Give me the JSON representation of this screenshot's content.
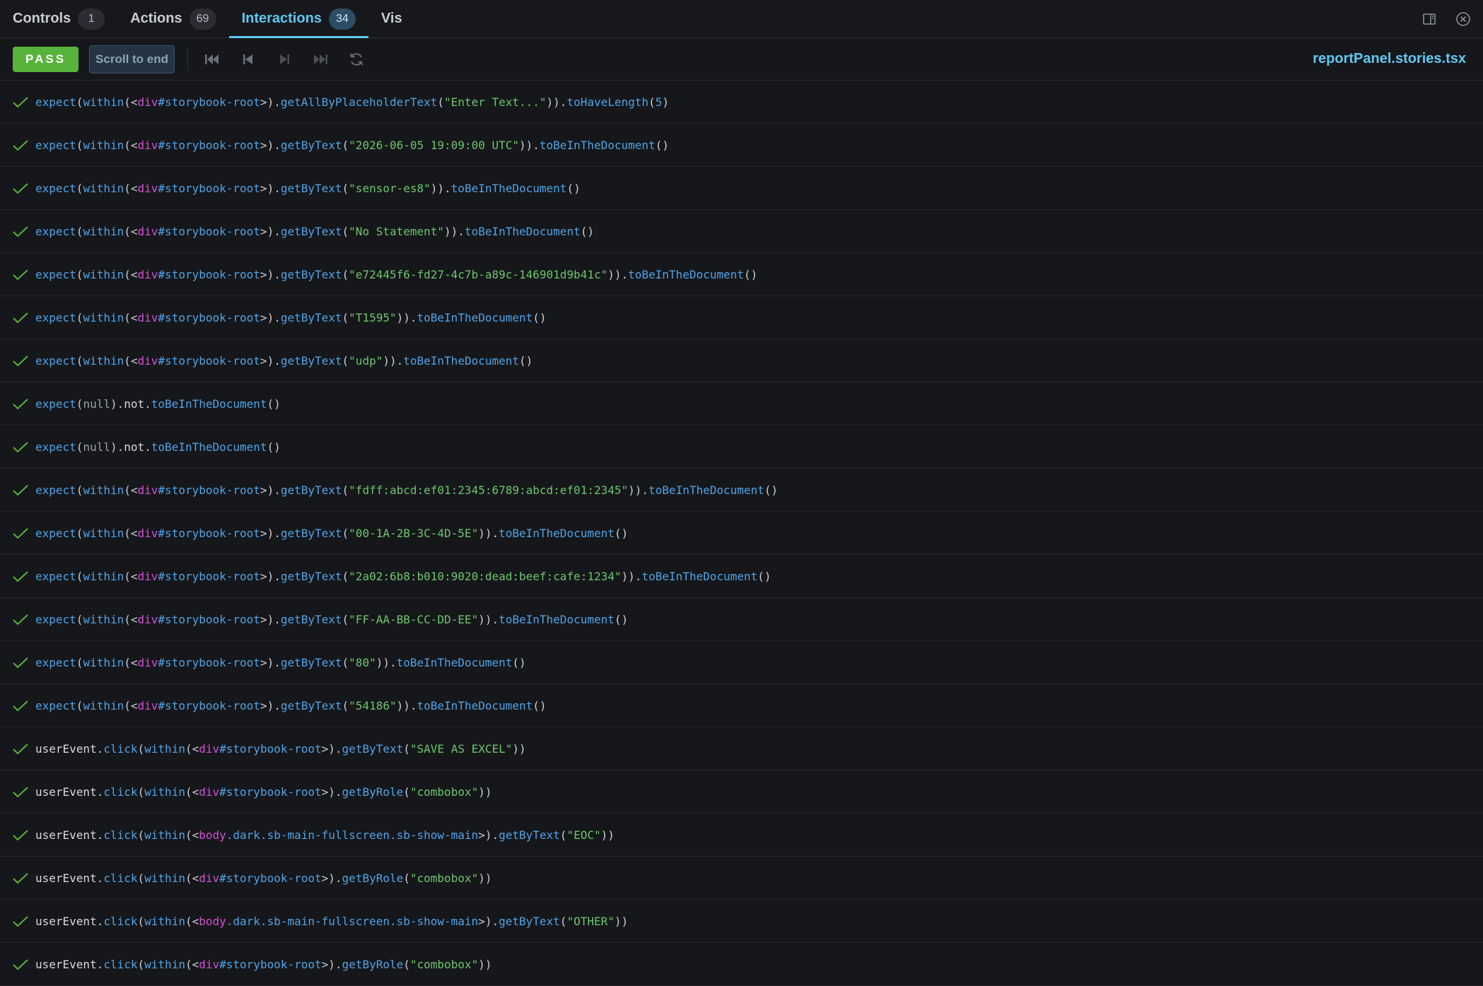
{
  "tabs": [
    {
      "label": "Controls",
      "count": "1"
    },
    {
      "label": "Actions",
      "count": "69"
    },
    {
      "label": "Interactions",
      "count": "34"
    },
    {
      "label": "Vis"
    }
  ],
  "toolbar": {
    "status": "PASS",
    "scroll_label": "Scroll to end",
    "filename": "reportPanel.stories.tsx"
  },
  "rows": [
    {
      "parts": [
        [
          "kw",
          "expect"
        ],
        [
          "pl",
          "("
        ],
        [
          "kw",
          "within"
        ],
        [
          "pl",
          "("
        ],
        [
          "pl",
          "<"
        ],
        [
          "el",
          "div"
        ],
        [
          "sel",
          "#storybook-root"
        ],
        [
          "pl",
          ">"
        ],
        [
          "pl",
          ")."
        ],
        [
          "kw",
          "getAllByPlaceholderText"
        ],
        [
          "pl",
          "("
        ],
        [
          "str",
          "\"Enter Text...\""
        ],
        [
          "pl",
          "))."
        ],
        [
          "kw",
          "toHaveLength"
        ],
        [
          "pl",
          "("
        ],
        [
          "num",
          "5"
        ],
        [
          "pl",
          ")"
        ]
      ]
    },
    {
      "parts": [
        [
          "kw",
          "expect"
        ],
        [
          "pl",
          "("
        ],
        [
          "kw",
          "within"
        ],
        [
          "pl",
          "("
        ],
        [
          "pl",
          "<"
        ],
        [
          "el",
          "div"
        ],
        [
          "sel",
          "#storybook-root"
        ],
        [
          "pl",
          ">"
        ],
        [
          "pl",
          ")."
        ],
        [
          "kw",
          "getByText"
        ],
        [
          "pl",
          "("
        ],
        [
          "str",
          "\"2026-06-05 19:09:00 UTC\""
        ],
        [
          "pl",
          "))."
        ],
        [
          "kw",
          "toBeInTheDocument"
        ],
        [
          "pl",
          "()"
        ]
      ]
    },
    {
      "parts": [
        [
          "kw",
          "expect"
        ],
        [
          "pl",
          "("
        ],
        [
          "kw",
          "within"
        ],
        [
          "pl",
          "("
        ],
        [
          "pl",
          "<"
        ],
        [
          "el",
          "div"
        ],
        [
          "sel",
          "#storybook-root"
        ],
        [
          "pl",
          ">"
        ],
        [
          "pl",
          ")."
        ],
        [
          "kw",
          "getByText"
        ],
        [
          "pl",
          "("
        ],
        [
          "str",
          "\"sensor-es8\""
        ],
        [
          "pl",
          "))."
        ],
        [
          "kw",
          "toBeInTheDocument"
        ],
        [
          "pl",
          "()"
        ]
      ]
    },
    {
      "parts": [
        [
          "kw",
          "expect"
        ],
        [
          "pl",
          "("
        ],
        [
          "kw",
          "within"
        ],
        [
          "pl",
          "("
        ],
        [
          "pl",
          "<"
        ],
        [
          "el",
          "div"
        ],
        [
          "sel",
          "#storybook-root"
        ],
        [
          "pl",
          ">"
        ],
        [
          "pl",
          ")."
        ],
        [
          "kw",
          "getByText"
        ],
        [
          "pl",
          "("
        ],
        [
          "str",
          "\"No Statement\""
        ],
        [
          "pl",
          "))."
        ],
        [
          "kw",
          "toBeInTheDocument"
        ],
        [
          "pl",
          "()"
        ]
      ]
    },
    {
      "parts": [
        [
          "kw",
          "expect"
        ],
        [
          "pl",
          "("
        ],
        [
          "kw",
          "within"
        ],
        [
          "pl",
          "("
        ],
        [
          "pl",
          "<"
        ],
        [
          "el",
          "div"
        ],
        [
          "sel",
          "#storybook-root"
        ],
        [
          "pl",
          ">"
        ],
        [
          "pl",
          ")."
        ],
        [
          "kw",
          "getByText"
        ],
        [
          "pl",
          "("
        ],
        [
          "str",
          "\"e72445f6-fd27-4c7b-a89c-146901d9b41c\""
        ],
        [
          "pl",
          "))."
        ],
        [
          "kw",
          "toBeInTheDocument"
        ],
        [
          "pl",
          "()"
        ]
      ]
    },
    {
      "parts": [
        [
          "kw",
          "expect"
        ],
        [
          "pl",
          "("
        ],
        [
          "kw",
          "within"
        ],
        [
          "pl",
          "("
        ],
        [
          "pl",
          "<"
        ],
        [
          "el",
          "div"
        ],
        [
          "sel",
          "#storybook-root"
        ],
        [
          "pl",
          ">"
        ],
        [
          "pl",
          ")."
        ],
        [
          "kw",
          "getByText"
        ],
        [
          "pl",
          "("
        ],
        [
          "str",
          "\"T1595\""
        ],
        [
          "pl",
          "))."
        ],
        [
          "kw",
          "toBeInTheDocument"
        ],
        [
          "pl",
          "()"
        ]
      ]
    },
    {
      "parts": [
        [
          "kw",
          "expect"
        ],
        [
          "pl",
          "("
        ],
        [
          "kw",
          "within"
        ],
        [
          "pl",
          "("
        ],
        [
          "pl",
          "<"
        ],
        [
          "el",
          "div"
        ],
        [
          "sel",
          "#storybook-root"
        ],
        [
          "pl",
          ">"
        ],
        [
          "pl",
          ")."
        ],
        [
          "kw",
          "getByText"
        ],
        [
          "pl",
          "("
        ],
        [
          "str",
          "\"udp\""
        ],
        [
          "pl",
          "))."
        ],
        [
          "kw",
          "toBeInTheDocument"
        ],
        [
          "pl",
          "()"
        ]
      ]
    },
    {
      "parts": [
        [
          "kw",
          "expect"
        ],
        [
          "pl",
          "("
        ],
        [
          "nul",
          "null"
        ],
        [
          "pl",
          ")."
        ],
        [
          "obj",
          "not"
        ],
        [
          "pl",
          "."
        ],
        [
          "kw",
          "toBeInTheDocument"
        ],
        [
          "pl",
          "()"
        ]
      ]
    },
    {
      "parts": [
        [
          "kw",
          "expect"
        ],
        [
          "pl",
          "("
        ],
        [
          "nul",
          "null"
        ],
        [
          "pl",
          ")."
        ],
        [
          "obj",
          "not"
        ],
        [
          "pl",
          "."
        ],
        [
          "kw",
          "toBeInTheDocument"
        ],
        [
          "pl",
          "()"
        ]
      ]
    },
    {
      "parts": [
        [
          "kw",
          "expect"
        ],
        [
          "pl",
          "("
        ],
        [
          "kw",
          "within"
        ],
        [
          "pl",
          "("
        ],
        [
          "pl",
          "<"
        ],
        [
          "el",
          "div"
        ],
        [
          "sel",
          "#storybook-root"
        ],
        [
          "pl",
          ">"
        ],
        [
          "pl",
          ")."
        ],
        [
          "kw",
          "getByText"
        ],
        [
          "pl",
          "("
        ],
        [
          "str",
          "\"fdff:abcd:ef01:2345:6789:abcd:ef01:2345\""
        ],
        [
          "pl",
          "))."
        ],
        [
          "kw",
          "toBeInTheDocument"
        ],
        [
          "pl",
          "()"
        ]
      ]
    },
    {
      "parts": [
        [
          "kw",
          "expect"
        ],
        [
          "pl",
          "("
        ],
        [
          "kw",
          "within"
        ],
        [
          "pl",
          "("
        ],
        [
          "pl",
          "<"
        ],
        [
          "el",
          "div"
        ],
        [
          "sel",
          "#storybook-root"
        ],
        [
          "pl",
          ">"
        ],
        [
          "pl",
          ")."
        ],
        [
          "kw",
          "getByText"
        ],
        [
          "pl",
          "("
        ],
        [
          "str",
          "\"00-1A-2B-3C-4D-5E\""
        ],
        [
          "pl",
          "))."
        ],
        [
          "kw",
          "toBeInTheDocument"
        ],
        [
          "pl",
          "()"
        ]
      ]
    },
    {
      "parts": [
        [
          "kw",
          "expect"
        ],
        [
          "pl",
          "("
        ],
        [
          "kw",
          "within"
        ],
        [
          "pl",
          "("
        ],
        [
          "pl",
          "<"
        ],
        [
          "el",
          "div"
        ],
        [
          "sel",
          "#storybook-root"
        ],
        [
          "pl",
          ">"
        ],
        [
          "pl",
          ")."
        ],
        [
          "kw",
          "getByText"
        ],
        [
          "pl",
          "("
        ],
        [
          "str",
          "\"2a02:6b8:b010:9020:dead:beef:cafe:1234\""
        ],
        [
          "pl",
          "))."
        ],
        [
          "kw",
          "toBeInTheDocument"
        ],
        [
          "pl",
          "()"
        ]
      ]
    },
    {
      "parts": [
        [
          "kw",
          "expect"
        ],
        [
          "pl",
          "("
        ],
        [
          "kw",
          "within"
        ],
        [
          "pl",
          "("
        ],
        [
          "pl",
          "<"
        ],
        [
          "el",
          "div"
        ],
        [
          "sel",
          "#storybook-root"
        ],
        [
          "pl",
          ">"
        ],
        [
          "pl",
          ")."
        ],
        [
          "kw",
          "getByText"
        ],
        [
          "pl",
          "("
        ],
        [
          "str",
          "\"FF-AA-BB-CC-DD-EE\""
        ],
        [
          "pl",
          "))."
        ],
        [
          "kw",
          "toBeInTheDocument"
        ],
        [
          "pl",
          "()"
        ]
      ]
    },
    {
      "parts": [
        [
          "kw",
          "expect"
        ],
        [
          "pl",
          "("
        ],
        [
          "kw",
          "within"
        ],
        [
          "pl",
          "("
        ],
        [
          "pl",
          "<"
        ],
        [
          "el",
          "div"
        ],
        [
          "sel",
          "#storybook-root"
        ],
        [
          "pl",
          ">"
        ],
        [
          "pl",
          ")."
        ],
        [
          "kw",
          "getByText"
        ],
        [
          "pl",
          "("
        ],
        [
          "str",
          "\"80\""
        ],
        [
          "pl",
          "))."
        ],
        [
          "kw",
          "toBeInTheDocument"
        ],
        [
          "pl",
          "()"
        ]
      ]
    },
    {
      "parts": [
        [
          "kw",
          "expect"
        ],
        [
          "pl",
          "("
        ],
        [
          "kw",
          "within"
        ],
        [
          "pl",
          "("
        ],
        [
          "pl",
          "<"
        ],
        [
          "el",
          "div"
        ],
        [
          "sel",
          "#storybook-root"
        ],
        [
          "pl",
          ">"
        ],
        [
          "pl",
          ")."
        ],
        [
          "kw",
          "getByText"
        ],
        [
          "pl",
          "("
        ],
        [
          "str",
          "\"54186\""
        ],
        [
          "pl",
          "))."
        ],
        [
          "kw",
          "toBeInTheDocument"
        ],
        [
          "pl",
          "()"
        ]
      ]
    },
    {
      "parts": [
        [
          "obj",
          "userEvent"
        ],
        [
          "pl",
          "."
        ],
        [
          "kw",
          "click"
        ],
        [
          "pl",
          "("
        ],
        [
          "kw",
          "within"
        ],
        [
          "pl",
          "("
        ],
        [
          "pl",
          "<"
        ],
        [
          "el",
          "div"
        ],
        [
          "sel",
          "#storybook-root"
        ],
        [
          "pl",
          ">"
        ],
        [
          "pl",
          ")."
        ],
        [
          "kw",
          "getByText"
        ],
        [
          "pl",
          "("
        ],
        [
          "str",
          "\"SAVE AS EXCEL\""
        ],
        [
          "pl",
          "))"
        ]
      ]
    },
    {
      "parts": [
        [
          "obj",
          "userEvent"
        ],
        [
          "pl",
          "."
        ],
        [
          "kw",
          "click"
        ],
        [
          "pl",
          "("
        ],
        [
          "kw",
          "within"
        ],
        [
          "pl",
          "("
        ],
        [
          "pl",
          "<"
        ],
        [
          "el",
          "div"
        ],
        [
          "sel",
          "#storybook-root"
        ],
        [
          "pl",
          ">"
        ],
        [
          "pl",
          ")."
        ],
        [
          "kw",
          "getByRole"
        ],
        [
          "pl",
          "("
        ],
        [
          "str",
          "\"combobox\""
        ],
        [
          "pl",
          "))"
        ]
      ]
    },
    {
      "parts": [
        [
          "obj",
          "userEvent"
        ],
        [
          "pl",
          "."
        ],
        [
          "kw",
          "click"
        ],
        [
          "pl",
          "("
        ],
        [
          "kw",
          "within"
        ],
        [
          "pl",
          "("
        ],
        [
          "pl",
          "<"
        ],
        [
          "el",
          "body"
        ],
        [
          "sel",
          ".dark.sb-main-fullscreen.sb-show-main"
        ],
        [
          "pl",
          ">"
        ],
        [
          "pl",
          ")."
        ],
        [
          "kw",
          "getByText"
        ],
        [
          "pl",
          "("
        ],
        [
          "str",
          "\"EOC\""
        ],
        [
          "pl",
          "))"
        ]
      ]
    },
    {
      "parts": [
        [
          "obj",
          "userEvent"
        ],
        [
          "pl",
          "."
        ],
        [
          "kw",
          "click"
        ],
        [
          "pl",
          "("
        ],
        [
          "kw",
          "within"
        ],
        [
          "pl",
          "("
        ],
        [
          "pl",
          "<"
        ],
        [
          "el",
          "div"
        ],
        [
          "sel",
          "#storybook-root"
        ],
        [
          "pl",
          ">"
        ],
        [
          "pl",
          ")."
        ],
        [
          "kw",
          "getByRole"
        ],
        [
          "pl",
          "("
        ],
        [
          "str",
          "\"combobox\""
        ],
        [
          "pl",
          "))"
        ]
      ]
    },
    {
      "parts": [
        [
          "obj",
          "userEvent"
        ],
        [
          "pl",
          "."
        ],
        [
          "kw",
          "click"
        ],
        [
          "pl",
          "("
        ],
        [
          "kw",
          "within"
        ],
        [
          "pl",
          "("
        ],
        [
          "pl",
          "<"
        ],
        [
          "el",
          "body"
        ],
        [
          "sel",
          ".dark.sb-main-fullscreen.sb-show-main"
        ],
        [
          "pl",
          ">"
        ],
        [
          "pl",
          ")."
        ],
        [
          "kw",
          "getByText"
        ],
        [
          "pl",
          "("
        ],
        [
          "str",
          "\"OTHER\""
        ],
        [
          "pl",
          "))"
        ]
      ]
    },
    {
      "parts": [
        [
          "obj",
          "userEvent"
        ],
        [
          "pl",
          "."
        ],
        [
          "kw",
          "click"
        ],
        [
          "pl",
          "("
        ],
        [
          "kw",
          "within"
        ],
        [
          "pl",
          "("
        ],
        [
          "pl",
          "<"
        ],
        [
          "el",
          "div"
        ],
        [
          "sel",
          "#storybook-root"
        ],
        [
          "pl",
          ">"
        ],
        [
          "pl",
          ")."
        ],
        [
          "kw",
          "getByRole"
        ],
        [
          "pl",
          "("
        ],
        [
          "str",
          "\"combobox\""
        ],
        [
          "pl",
          "))"
        ]
      ]
    }
  ]
}
